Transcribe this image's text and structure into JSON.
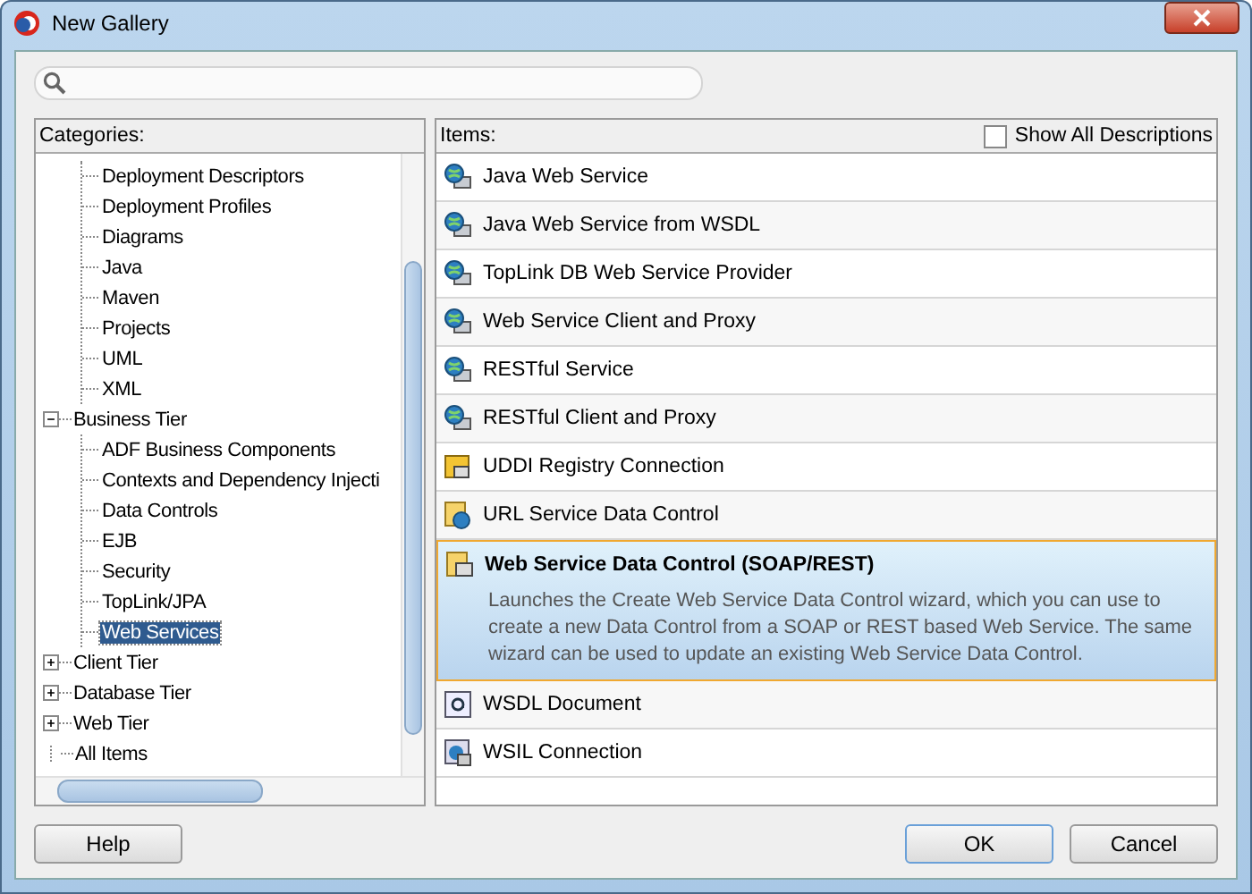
{
  "window": {
    "title": "New Gallery"
  },
  "categories": {
    "label": "Categories:",
    "tree": [
      {
        "children": [
          {
            "label": "Deployment Descriptors",
            "selected": false
          },
          {
            "label": "Deployment Profiles",
            "selected": false
          },
          {
            "label": "Diagrams",
            "selected": false
          },
          {
            "label": "Java",
            "selected": false
          },
          {
            "label": "Maven",
            "selected": false
          },
          {
            "label": "Projects",
            "selected": false
          },
          {
            "label": "UML",
            "selected": false
          },
          {
            "label": "XML",
            "selected": false
          }
        ]
      },
      {
        "label": "Business Tier",
        "selected": false,
        "expanded": true,
        "children": [
          {
            "label": "ADF Business Components",
            "selected": false
          },
          {
            "label": "Contexts and Dependency Injecti",
            "selected": false
          },
          {
            "label": "Data Controls",
            "selected": false
          },
          {
            "label": "EJB",
            "selected": false
          },
          {
            "label": "Security",
            "selected": false
          },
          {
            "label": "TopLink/JPA",
            "selected": false
          },
          {
            "label": "Web Services",
            "selected": true
          }
        ]
      },
      {
        "label": "Client Tier",
        "selected": false,
        "expanded": false
      },
      {
        "label": "Database Tier",
        "selected": false,
        "expanded": false
      },
      {
        "label": "Web Tier",
        "selected": false,
        "expanded": false
      },
      {
        "label": "All Items",
        "selected": false
      }
    ]
  },
  "items": {
    "label": "Items:",
    "show_all_descriptions": {
      "label": "Show All Descriptions",
      "checked": false
    },
    "list": [
      {
        "kind": "globe",
        "label": "Java Web Service",
        "selected": false
      },
      {
        "kind": "globe",
        "label": "Java Web Service from WSDL",
        "selected": false
      },
      {
        "kind": "globe",
        "label": "TopLink DB Web Service Provider",
        "selected": false
      },
      {
        "kind": "globe",
        "label": "Web Service Client and Proxy",
        "selected": false
      },
      {
        "kind": "globe",
        "label": "RESTful Service",
        "selected": false
      },
      {
        "kind": "globe",
        "label": "RESTful Client and Proxy",
        "selected": false
      },
      {
        "kind": "registry",
        "label": "UDDI Registry Connection",
        "selected": false
      },
      {
        "kind": "url",
        "label": "URL Service Data Control",
        "selected": false
      },
      {
        "kind": "datacontrol",
        "label": "Web Service Data Control (SOAP/REST)",
        "selected": true,
        "description": "Launches the Create Web Service Data Control wizard, which you can use to create a new Data Control from a SOAP or REST based Web Service. The same wizard can be used to update an existing Web Service Data Control."
      },
      {
        "kind": "wsdl",
        "label": "WSDL Document",
        "selected": false
      },
      {
        "kind": "wsil",
        "label": "WSIL Connection",
        "selected": false
      }
    ]
  },
  "buttons": {
    "help": "Help",
    "ok": "OK",
    "cancel": "Cancel"
  }
}
